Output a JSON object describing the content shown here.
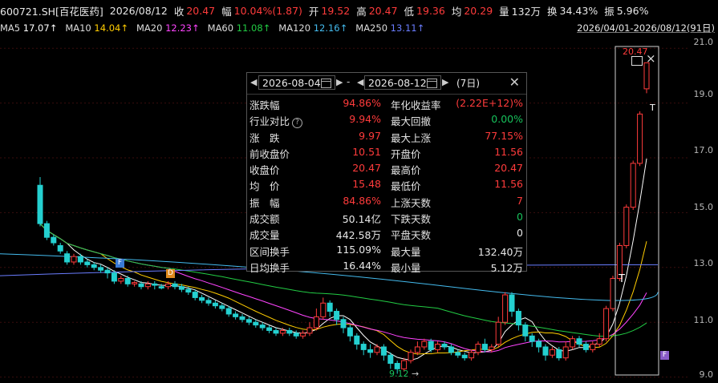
{
  "quote": {
    "code": "600721.SH[百花医药]",
    "date": "2026/08/12",
    "close_label": "收",
    "close": "20.47",
    "change_label": "幅",
    "change": "10.04%(1.87)",
    "open_label": "开",
    "open": "19.52",
    "high_label": "高",
    "high": "20.47",
    "low_label": "低",
    "low": "19.36",
    "avg_label": "均",
    "avg": "20.29",
    "volume_label": "量",
    "volume": "132万",
    "turnover_label": "换",
    "turnover": "34.43%",
    "amplitude_label": "振",
    "amplitude": "5.96%"
  },
  "ma_legend": [
    {
      "label": "MA5",
      "value": "17.07↑",
      "color": "#ffffff"
    },
    {
      "label": "MA10",
      "value": "14.04↑",
      "color": "#ffcc00"
    },
    {
      "label": "MA20",
      "value": "12.23↑",
      "color": "#ff44ff"
    },
    {
      "label": "MA60",
      "value": "11.08↑",
      "color": "#22cc44"
    },
    {
      "label": "MA120",
      "value": "12.16↑",
      "color": "#44bbee"
    },
    {
      "label": "MA250",
      "value": "13.11↑",
      "color": "#6a7dff"
    }
  ],
  "date_range": "2026/04/01-2026/08/12(91日)",
  "y_axis": [
    "21.0",
    "19.0",
    "17.0",
    "15.0",
    "13.0",
    "11.0",
    "9.0"
  ],
  "chart_data": {
    "type": "candlestick",
    "ylim": [
      8.9,
      21.3
    ],
    "candles": [
      [
        16.0,
        14.6,
        16.3,
        14.5
      ],
      [
        14.6,
        14.1,
        14.7,
        14.0
      ],
      [
        14.1,
        13.9,
        14.2,
        13.8
      ],
      [
        13.8,
        13.6,
        13.9,
        13.5
      ],
      [
        13.5,
        13.2,
        13.6,
        13.1
      ],
      [
        13.2,
        13.4,
        13.5,
        13.1
      ],
      [
        13.4,
        13.2,
        13.5,
        13.1
      ],
      [
        13.2,
        13.1,
        13.3,
        13.0
      ],
      [
        13.1,
        13.0,
        13.2,
        12.9
      ],
      [
        13.0,
        12.9,
        13.1,
        12.8
      ],
      [
        12.9,
        12.8,
        13.0,
        12.6
      ],
      [
        12.8,
        12.5,
        12.9,
        12.4
      ],
      [
        12.5,
        12.6,
        12.7,
        12.4
      ],
      [
        12.6,
        12.4,
        12.7,
        12.3
      ],
      [
        12.4,
        12.45,
        12.5,
        12.3
      ],
      [
        12.4,
        12.3,
        12.5,
        12.2
      ],
      [
        12.3,
        12.4,
        12.5,
        12.2
      ],
      [
        12.4,
        12.35,
        12.5,
        12.2
      ],
      [
        12.3,
        12.25,
        12.4,
        12.2
      ],
      [
        12.3,
        12.4,
        12.5,
        12.2
      ],
      [
        12.4,
        12.3,
        12.5,
        12.2
      ],
      [
        12.3,
        12.2,
        12.4,
        12.1
      ],
      [
        12.2,
        12.1,
        12.3,
        12.0
      ],
      [
        12.1,
        11.9,
        12.2,
        11.8
      ],
      [
        11.9,
        11.8,
        12.0,
        11.7
      ],
      [
        11.8,
        11.7,
        11.9,
        11.6
      ],
      [
        11.7,
        11.6,
        11.8,
        11.5
      ],
      [
        11.6,
        11.5,
        11.7,
        11.4
      ],
      [
        11.5,
        11.3,
        11.6,
        11.2
      ],
      [
        11.3,
        11.2,
        11.4,
        11.1
      ],
      [
        11.2,
        11.1,
        11.3,
        11.0
      ],
      [
        11.1,
        11.0,
        11.2,
        10.9
      ],
      [
        11.0,
        10.9,
        11.1,
        10.8
      ],
      [
        10.9,
        10.8,
        11.0,
        10.7
      ],
      [
        10.8,
        10.7,
        10.9,
        10.6
      ],
      [
        10.7,
        10.6,
        10.8,
        10.5
      ],
      [
        10.6,
        10.7,
        10.8,
        10.5
      ],
      [
        10.7,
        10.6,
        10.8,
        10.5
      ],
      [
        10.6,
        10.5,
        10.7,
        10.4
      ],
      [
        10.5,
        10.6,
        10.7,
        10.4
      ],
      [
        10.6,
        10.8,
        11.0,
        10.5
      ],
      [
        10.8,
        11.2,
        11.5,
        10.7
      ],
      [
        11.2,
        11.7,
        11.9,
        11.1
      ],
      [
        11.7,
        11.4,
        11.8,
        11.2
      ],
      [
        11.4,
        11.1,
        11.5,
        10.9
      ],
      [
        11.1,
        10.8,
        11.2,
        10.6
      ],
      [
        10.8,
        10.5,
        10.9,
        10.3
      ],
      [
        10.5,
        10.2,
        10.6,
        10.0
      ],
      [
        10.2,
        10.0,
        10.3,
        9.8
      ],
      [
        10.0,
        9.9,
        10.2,
        9.7
      ],
      [
        9.9,
        10.1,
        10.2,
        9.8
      ],
      [
        10.1,
        9.8,
        10.2,
        9.6
      ],
      [
        9.8,
        9.5,
        9.9,
        9.3
      ],
      [
        9.5,
        9.3,
        9.6,
        9.12
      ],
      [
        9.3,
        9.6,
        9.7,
        9.2
      ],
      [
        9.6,
        9.9,
        10.0,
        9.5
      ],
      [
        9.9,
        10.1,
        10.3,
        9.8
      ],
      [
        10.1,
        10.3,
        10.4,
        10.0
      ],
      [
        10.3,
        10.0,
        10.4,
        9.9
      ],
      [
        10.0,
        10.2,
        10.3,
        9.9
      ],
      [
        10.2,
        10.1,
        10.3,
        10.0
      ],
      [
        10.1,
        9.9,
        10.2,
        9.8
      ],
      [
        9.9,
        9.8,
        10.0,
        9.7
      ],
      [
        9.8,
        9.7,
        9.9,
        9.6
      ],
      [
        9.7,
        9.9,
        10.0,
        9.6
      ],
      [
        9.9,
        10.2,
        10.3,
        9.8
      ],
      [
        10.2,
        10.0,
        10.4,
        9.9
      ],
      [
        10.0,
        10.1,
        10.2,
        9.9
      ],
      [
        10.2,
        11.0,
        11.2,
        10.1
      ],
      [
        11.0,
        12.0,
        12.1,
        10.9
      ],
      [
        12.0,
        11.4,
        12.1,
        11.2
      ],
      [
        11.4,
        10.9,
        11.5,
        10.7
      ],
      [
        10.9,
        10.5,
        11.0,
        10.3
      ],
      [
        10.5,
        10.3,
        10.6,
        10.1
      ],
      [
        10.3,
        10.1,
        10.4,
        9.9
      ],
      [
        10.1,
        9.8,
        10.2,
        9.6
      ],
      [
        9.8,
        10.0,
        10.1,
        9.7
      ],
      [
        10.0,
        9.7,
        10.1,
        9.6
      ],
      [
        9.7,
        10.1,
        10.3,
        9.6
      ],
      [
        10.1,
        10.4,
        10.5,
        10.0
      ],
      [
        10.4,
        10.2,
        10.5,
        10.1
      ],
      [
        10.2,
        10.0,
        10.3,
        9.9
      ],
      [
        10.0,
        10.2,
        10.3,
        9.9
      ],
      [
        10.2,
        10.4,
        10.6,
        10.1
      ],
      [
        10.4,
        11.5,
        11.6,
        10.3
      ],
      [
        11.5,
        12.6,
        12.7,
        11.4
      ],
      [
        12.6,
        13.8,
        13.9,
        12.5
      ],
      [
        13.8,
        15.2,
        15.3,
        13.7
      ],
      [
        15.2,
        16.8,
        16.9,
        15.1
      ],
      [
        16.8,
        18.6,
        18.7,
        16.7
      ],
      [
        19.52,
        20.47,
        20.47,
        19.36
      ]
    ]
  },
  "markers": {
    "f1": "F",
    "d1": "D",
    "f2": "F",
    "t1": "T",
    "t2": "T",
    "top_price": "20.47",
    "low_price": "9.12",
    "low_arrow": "→",
    "flag": "F"
  },
  "popup": {
    "start_date": "2026-08-04",
    "end_date": "2026-08-12",
    "dash": "-",
    "days": "(7日)",
    "stats": [
      {
        "l1": "涨跌幅",
        "v1": "94.86%",
        "c1": "r",
        "l2": "年化收益率",
        "v2": "(2.22E+12)%",
        "c2": "r",
        "q1": false
      },
      {
        "l1": "行业对比",
        "v1": "9.94%",
        "c1": "r",
        "l2": "最大回撤",
        "v2": "0.00%",
        "c2": "g",
        "q1": true
      },
      {
        "l1": "涨　跌",
        "v1": "9.97",
        "c1": "r",
        "l2": "最大上涨",
        "v2": "77.15%",
        "c2": "r",
        "q1": false
      },
      {
        "l1": "前收盘价",
        "v1": "10.51",
        "c1": "r",
        "l2": "开盘价",
        "v2": "11.56",
        "c2": "r",
        "q1": false
      },
      {
        "l1": "收盘价",
        "v1": "20.47",
        "c1": "r",
        "l2": "最高价",
        "v2": "20.47",
        "c2": "r",
        "q1": false
      },
      {
        "l1": "均　价",
        "v1": "15.48",
        "c1": "r",
        "l2": "最低价",
        "v2": "11.56",
        "c2": "r",
        "q1": false
      },
      {
        "l1": "振　幅",
        "v1": "84.86%",
        "c1": "r",
        "l2": "上涨天数",
        "v2": "7",
        "c2": "r",
        "q1": false
      },
      {
        "l1": "成交额",
        "v1": "50.14亿",
        "c1": "w",
        "l2": "下跌天数",
        "v2": "0",
        "c2": "g",
        "q1": false
      },
      {
        "l1": "成交量",
        "v1": "442.58万",
        "c1": "w",
        "l2": "平盘天数",
        "v2": "0",
        "c2": "w",
        "q1": false
      },
      {
        "l1": "区间换手",
        "v1": "115.09%",
        "c1": "w",
        "l2": "最大量",
        "v2": "132.40万",
        "c2": "w",
        "q1": false
      },
      {
        "l1": "日均换手",
        "v1": "16.44%",
        "c1": "w",
        "l2": "最小量",
        "v2": "5.12万",
        "c2": "w",
        "q1": false
      }
    ]
  }
}
